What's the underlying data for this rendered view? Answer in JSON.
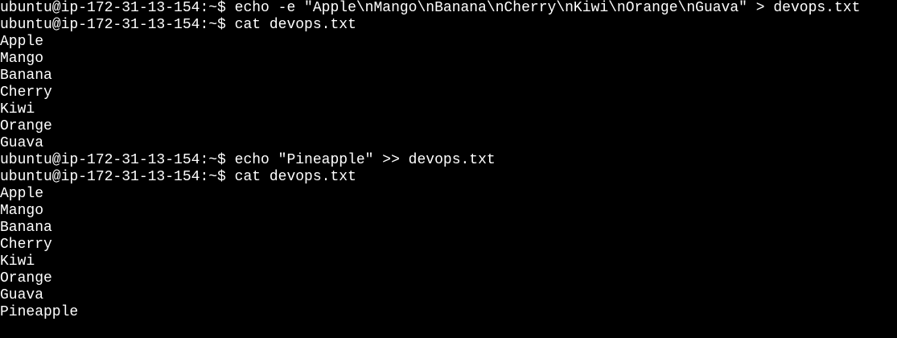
{
  "terminal": {
    "background": "#000000",
    "foreground": "#ffffff",
    "lines": [
      "ubuntu@ip-172-31-13-154:~$ echo -e \"Apple\\nMango\\nBanana\\nCherry\\nKiwi\\nOrange\\nGuava\" > devops.txt",
      "ubuntu@ip-172-31-13-154:~$ cat devops.txt",
      "Apple",
      "Mango",
      "Banana",
      "Cherry",
      "Kiwi",
      "Orange",
      "Guava",
      "ubuntu@ip-172-31-13-154:~$ echo \"Pineapple\" >> devops.txt",
      "ubuntu@ip-172-31-13-154:~$ cat devops.txt",
      "Apple",
      "Mango",
      "Banana",
      "Cherry",
      "Kiwi",
      "Orange",
      "Guava",
      "Pineapple"
    ]
  }
}
